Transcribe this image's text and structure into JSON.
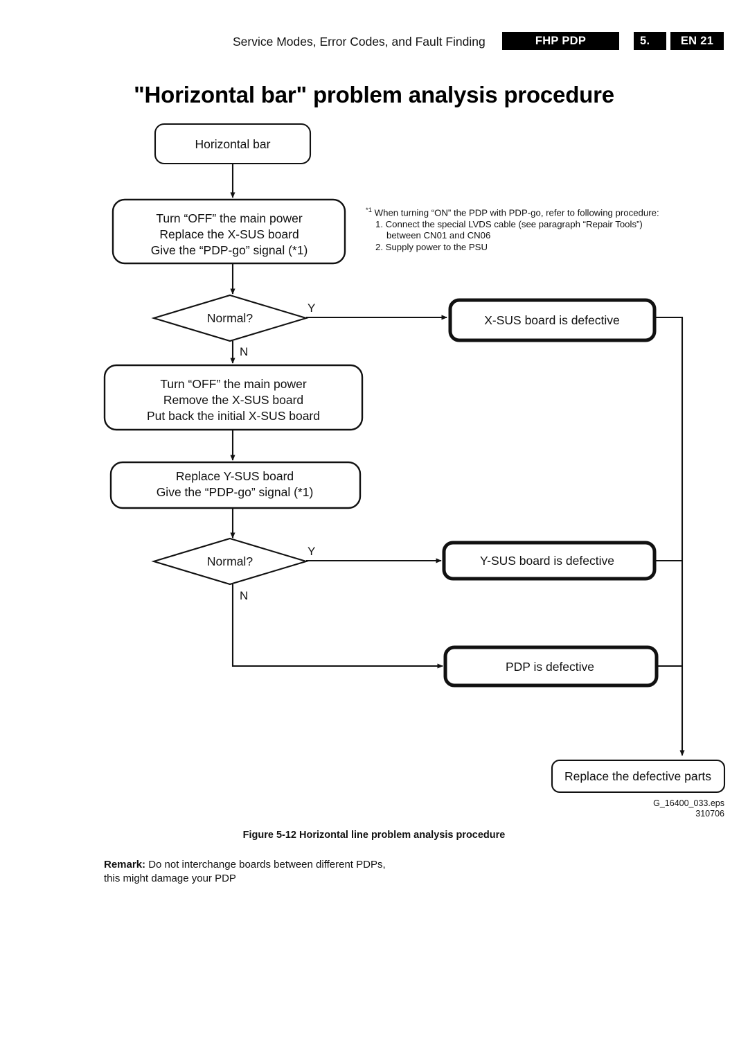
{
  "header": {
    "title": "Service Modes, Error Codes, and Fault Finding",
    "model_chip": "FHP PDP",
    "section_chip": "5.",
    "page_chip": "EN 21"
  },
  "doc_title": "\"Horizontal bar\" problem analysis procedure",
  "flowchart": {
    "nodes": {
      "start": {
        "label": "Horizontal bar"
      },
      "step1_line1": "Turn “OFF” the main power",
      "step1_line2": "Replace the X-SUS board",
      "step1_line3": "Give the “PDP-go” signal (*1)",
      "decision1": "Normal?",
      "xsus_defective": "X-SUS board is defective",
      "step2_line1": "Turn “OFF” the main power",
      "step2_line2": "Remove the X-SUS board",
      "step2_line3": "Put back the initial X-SUS board",
      "step3_line1": "Replace Y-SUS board",
      "step3_line2": "Give the “PDP-go” signal (*1)",
      "decision2": "Normal?",
      "ysus_defective": "Y-SUS board is defective",
      "pdp_defective": "PDP is defective",
      "replace_parts": "Replace the defective parts"
    },
    "branch_labels": {
      "yes": "Y",
      "no": "N"
    }
  },
  "footnote": {
    "marker": "*1",
    "intro": "When turning “ON” the PDP with PDP-go, refer to following procedure:",
    "item1": "1. Connect the special LVDS cable (see paragraph “Repair Tools”)",
    "item1_cont": "between CN01 and CN06",
    "item2": "2. Supply power to the PSU"
  },
  "eps_ref": {
    "filename": "G_16400_033.eps",
    "number": "310706"
  },
  "figure_caption": "Figure 5-12 Horizontal line problem analysis procedure",
  "remark": {
    "label": "Remark:",
    "line1": " Do not interchange boards between different PDPs,",
    "line2": "this might damage your PDP"
  }
}
